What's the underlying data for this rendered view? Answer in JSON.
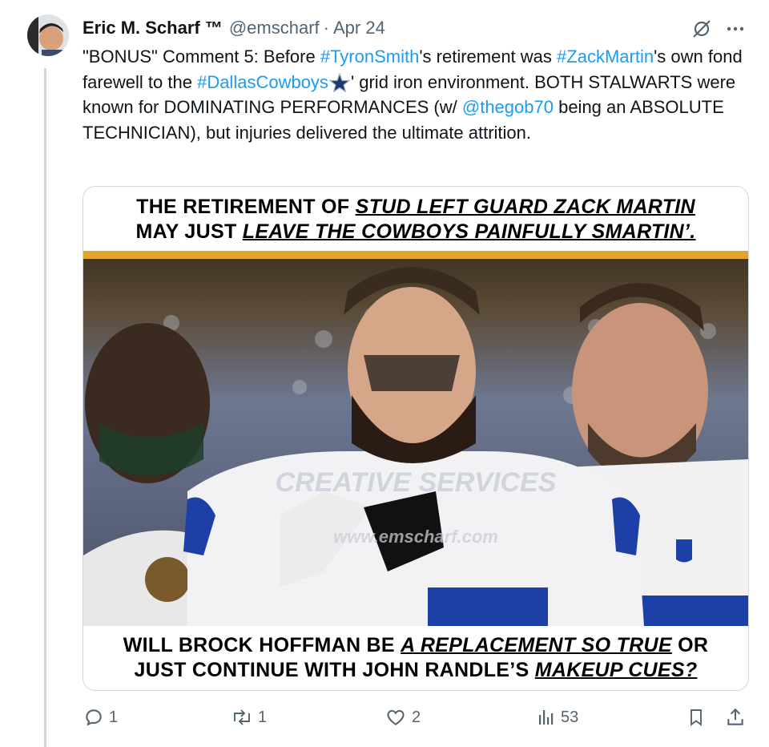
{
  "tweet": {
    "author_name": "Eric M. Scharf ™",
    "handle": "@emscharf",
    "separator": "·",
    "date": "Apr 24",
    "text": {
      "t1": "\"BONUS\" Comment 5: Before ",
      "h1": "#TyronSmith",
      "t2": "'s retirement was ",
      "h2": "#ZackMartin",
      "t3": "'s own fond farewell to the ",
      "h3": "#DallasCowboys",
      "t4": "' grid iron environment. BOTH STALWARTS were known for DOMINATING PERFORMANCES (w/ ",
      "mention": "@thegob70",
      "t5": " being an ABSOLUTE TECHNICIAN), but injuries delivered the ultimate attrition."
    }
  },
  "card": {
    "top_line1_plain": "THE RETIREMENT OF ",
    "top_line1_em": "STUD LEFT GUARD ZACK MARTIN",
    "top_line2_plain": "MAY JUST ",
    "top_line2_em": "LEAVE THE COWBOYS PAINFULLY SMARTIN’.",
    "watermark1": "CREATIVE SERVICES",
    "watermark2": "www.emscharf.com",
    "bottom_line1_plain_a": "WILL BROCK HOFFMAN BE ",
    "bottom_line1_em": "A REPLACEMENT SO TRUE",
    "bottom_line1_plain_b": " OR",
    "bottom_line2_plain": "JUST CONTINUE WITH JOHN RANDLE’S ",
    "bottom_line2_em": "MAKEUP CUES?"
  },
  "actions": {
    "replies": "1",
    "reposts": "1",
    "likes": "2",
    "views": "53"
  },
  "colors": {
    "link": "#1d9bf0",
    "muted": "#536471",
    "border": "#cfd9de"
  },
  "icons": [
    "grok-icon",
    "more-icon",
    "reply-icon",
    "repost-icon",
    "like-icon",
    "views-icon",
    "bookmark-icon",
    "share-icon",
    "cowboys-star-icon"
  ]
}
